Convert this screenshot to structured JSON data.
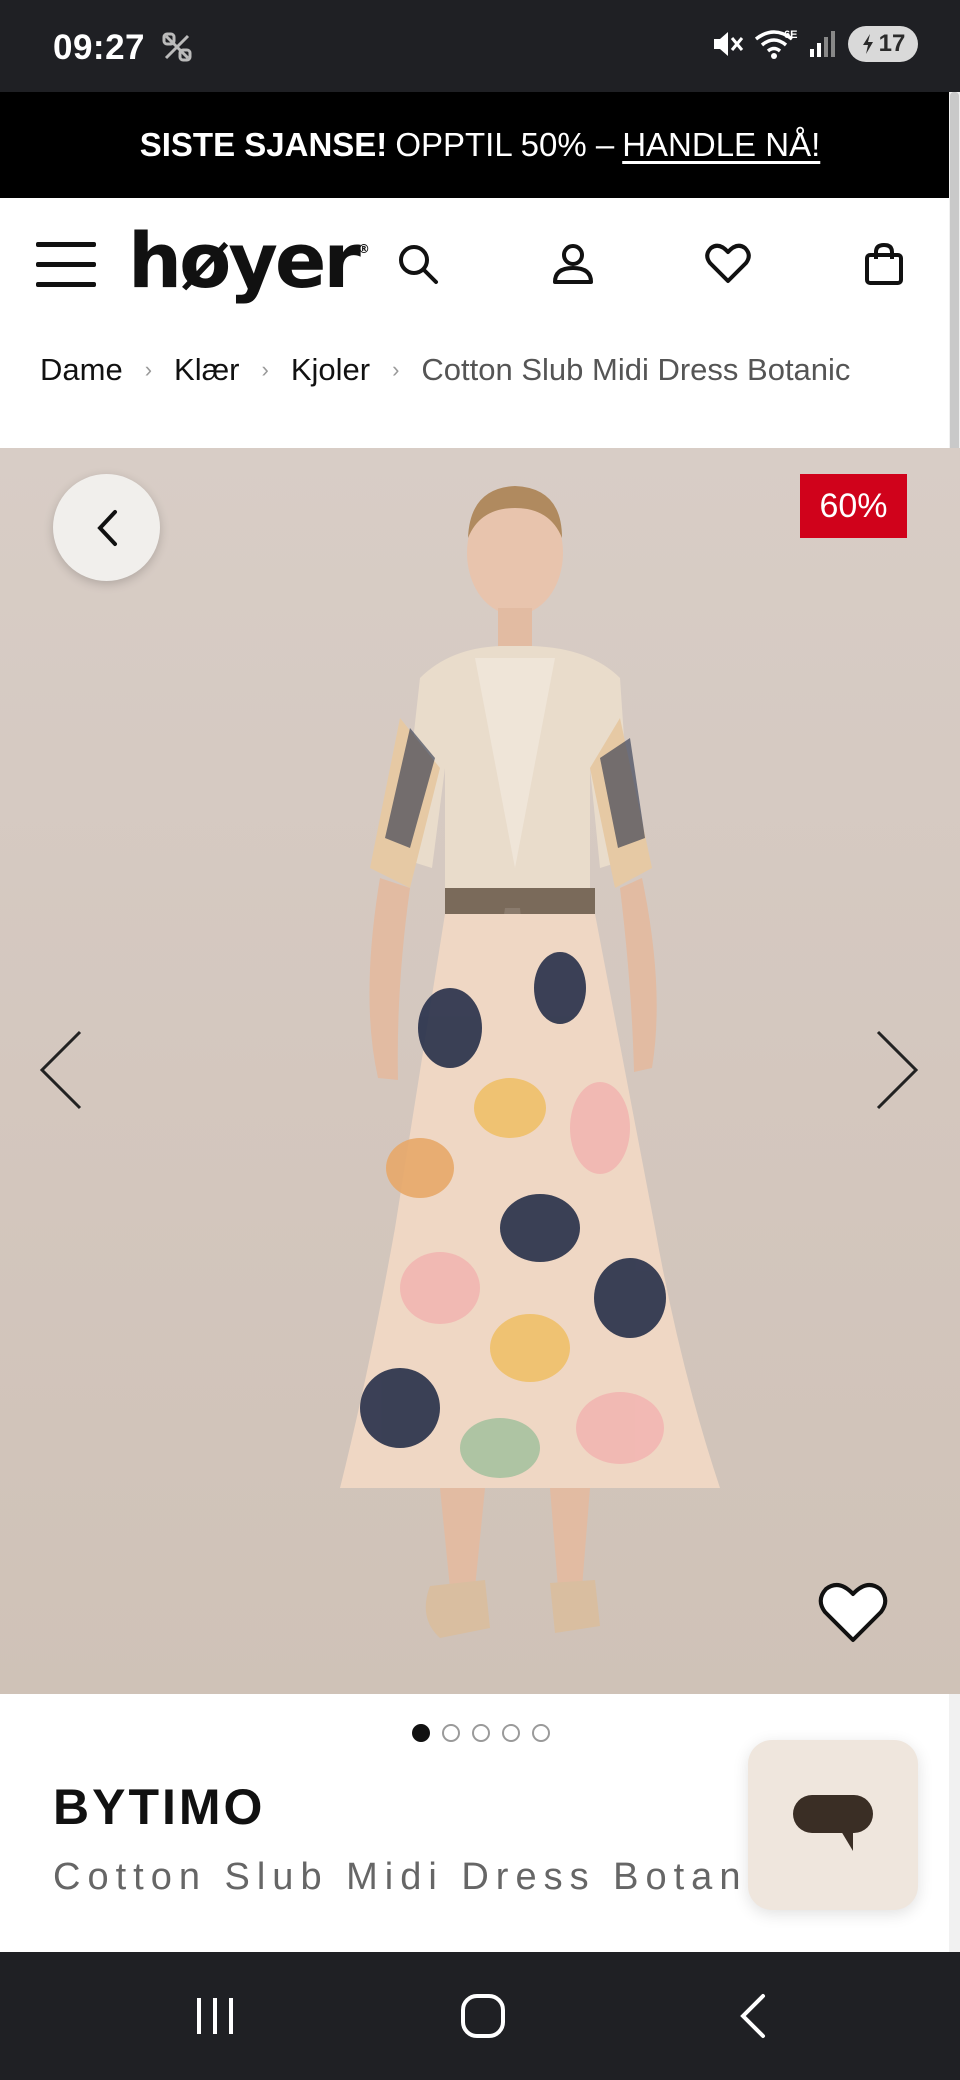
{
  "status_bar": {
    "time": "09:27",
    "battery_level": "17",
    "icons": [
      "mute-icon",
      "wifi-icon",
      "signal-icon",
      "battery-icon"
    ]
  },
  "promo": {
    "bold_text": "SISTE SJANSE!",
    "text": "OPPTIL 50% –",
    "link": "HANDLE NÅ!"
  },
  "header": {
    "logo": "høyer",
    "icons": [
      "menu-icon",
      "search-icon",
      "account-icon",
      "wishlist-icon",
      "cart-icon"
    ]
  },
  "breadcrumb": {
    "items": [
      "Dame",
      "Klær",
      "Kjoler"
    ],
    "current": "Cotton Slub Midi Dress Botanic",
    "separator": "›"
  },
  "gallery": {
    "discount": "60%",
    "image_count": 5,
    "active_index": 0
  },
  "product": {
    "brand": "BYTIMO",
    "name": "Cotton Slub Midi Dress Botanic"
  },
  "colors": {
    "promo_bg": "#000000",
    "badge_red": "#d0021b",
    "system_bar": "#1f2024",
    "chat_bg": "#efe6dd",
    "chat_icon": "#3a2e25"
  }
}
